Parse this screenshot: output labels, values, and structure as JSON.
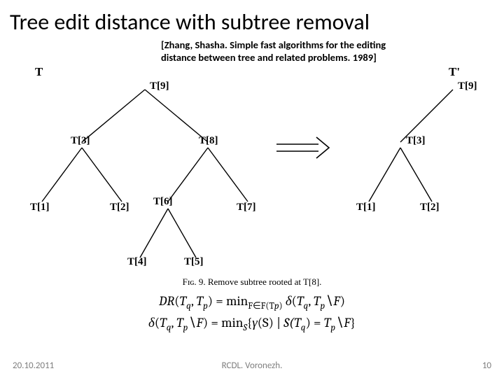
{
  "title": "Tree edit distance with subtree removal",
  "citation_line1": "[Zhang, Shasha. Simple fast algorithms for the editing",
  "citation_line2": "distance between tree and related problems. 1989]",
  "tree_labels": {
    "T": "T",
    "Tp": "T'"
  },
  "left_nodes": {
    "n9": "T[9]",
    "n3": "T[3]",
    "n8": "T[8]",
    "n1": "T[1]",
    "n2": "T[2]",
    "n6": "T[6]",
    "n7": "T[7]",
    "n4": "T[4]",
    "n5": "T[5]"
  },
  "right_nodes": {
    "n9": "T[9]",
    "n3": "T[3]",
    "n1": "T[1]",
    "n2": "T[2]"
  },
  "fig_caption": "Fɪɢ. 9.  Remove subtree rooted at T[8].",
  "formula": {
    "DR": "DR",
    "lp": "(",
    "rp": ")",
    "comma": ", ",
    "Tq": "T",
    "q": "q",
    "Tp": "T",
    "p": "p",
    "eq": " = ",
    "min": "min",
    "sub_F": "F∈F(T",
    "sub_Fclose": ")",
    "delta": "δ",
    "bs": "∖",
    "F": "F",
    "gamma": "γ",
    "S": "S",
    "mid": " | ",
    "set_open": "{",
    "set_close": "}",
    "sub_S": "S",
    "Sarg": "(S)",
    "STq": "S(T"
  },
  "footer": {
    "date": "20.10.2011",
    "venue": "RCDL. Voronezh.",
    "page": "10"
  }
}
